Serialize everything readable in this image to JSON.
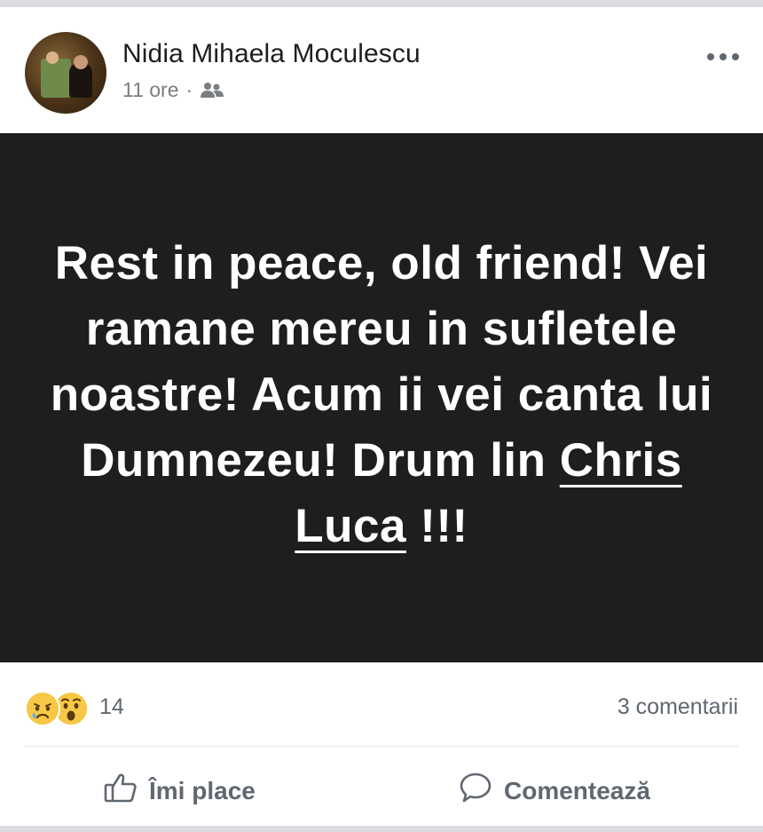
{
  "post": {
    "author": "Nidia Mihaela Moculescu",
    "time": "11 ore",
    "separator": "·",
    "audience_icon": "friends-icon",
    "more_icon": "more-options-icon",
    "message_part1": "Rest in peace, old friend! Vei ramane mereu in sufletele noastre! Acum ii vei canta lui Dumnezeu! Drum lin ",
    "mention": "Chris Luca",
    "message_part2": " !!!",
    "banner_bg": "#1e1e1e",
    "text_color": "#ffffff"
  },
  "reactions": {
    "icons": [
      "sad-reaction-icon",
      "wow-reaction-icon"
    ],
    "count": "14",
    "comments": "3 comentarii"
  },
  "actions": {
    "like_label": "Îmi place",
    "comment_label": "Comentează",
    "like_icon": "thumbs-up-icon",
    "comment_icon": "speech-bubble-icon"
  }
}
